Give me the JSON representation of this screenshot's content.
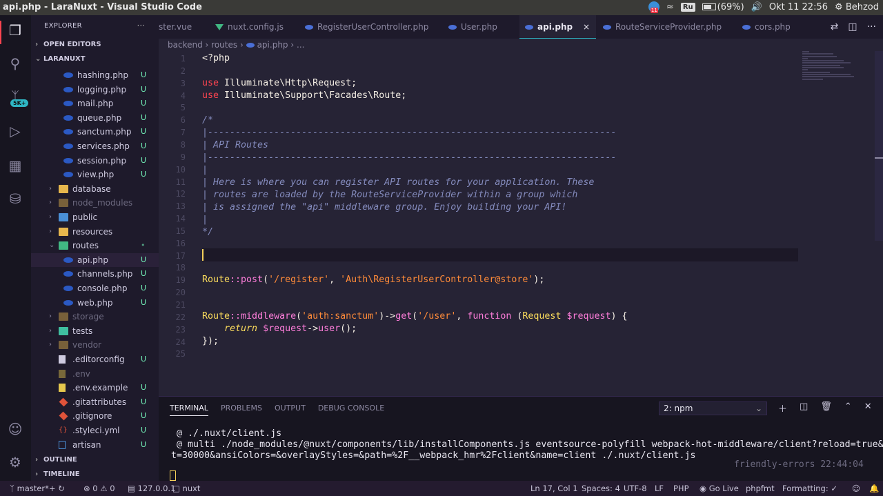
{
  "topbar": {
    "title": "api.php - LaraNuxt - Visual Studio Code",
    "keyboard": "Ru",
    "battery": "(69%)",
    "battery_level": 0.69,
    "datetime": "Okt 11 22:56",
    "user": "Behzod"
  },
  "sidebar": {
    "header": "EXPLORER",
    "dots": "···",
    "open_editors": "OPEN EDITORS",
    "project": "LARANUXT",
    "outline": "OUTLINE",
    "timeline": "TIMELINE",
    "items": [
      {
        "label": "hashing.php",
        "status": "U"
      },
      {
        "label": "logging.php",
        "status": "U"
      },
      {
        "label": "mail.php",
        "status": "U"
      },
      {
        "label": "queue.php",
        "status": "U"
      },
      {
        "label": "sanctum.php",
        "status": "U"
      },
      {
        "label": "services.php",
        "status": "U"
      },
      {
        "label": "session.php",
        "status": "U"
      },
      {
        "label": "view.php",
        "status": "U"
      },
      {
        "label": "database",
        "status": ""
      },
      {
        "label": "node_modules",
        "status": ""
      },
      {
        "label": "public",
        "status": ""
      },
      {
        "label": "resources",
        "status": ""
      },
      {
        "label": "routes",
        "status": ""
      },
      {
        "label": "api.php",
        "status": "U"
      },
      {
        "label": "channels.php",
        "status": "U"
      },
      {
        "label": "console.php",
        "status": "U"
      },
      {
        "label": "web.php",
        "status": "U"
      },
      {
        "label": "storage",
        "status": ""
      },
      {
        "label": "tests",
        "status": ""
      },
      {
        "label": "vendor",
        "status": ""
      },
      {
        "label": ".editorconfig",
        "status": "U"
      },
      {
        "label": ".env",
        "status": ""
      },
      {
        "label": ".env.example",
        "status": "U"
      },
      {
        "label": ".gitattributes",
        "status": "U"
      },
      {
        "label": ".gitignore",
        "status": "U"
      },
      {
        "label": ".styleci.yml",
        "status": "U"
      },
      {
        "label": "artisan",
        "status": "U"
      }
    ]
  },
  "tabs": [
    {
      "label": "ster.vue"
    },
    {
      "label": "nuxt.config.js"
    },
    {
      "label": "RegisterUserController.php"
    },
    {
      "label": "User.php"
    },
    {
      "label": "api.php",
      "close": "×"
    },
    {
      "label": "RouteServiceProvider.php"
    },
    {
      "label": "cors.php"
    }
  ],
  "breadcrumb": {
    "a": "backend",
    "b": "routes",
    "c": "api.php",
    "d": "..."
  },
  "editor": {
    "line_numbers": [
      "1",
      "2",
      "3",
      "4",
      "5",
      "6",
      "7",
      "8",
      "9",
      "10",
      "11",
      "12",
      "13",
      "14",
      "15",
      "16",
      "17",
      "18",
      "19",
      "20",
      "21",
      "22",
      "23",
      "24",
      "25"
    ],
    "code": {
      "l1": "<?php",
      "l3a": "use",
      "l3b": " Illuminate\\Http\\Request;",
      "l4a": "use",
      "l4b": " Illuminate\\Support\\Facades\\Route;",
      "l6": "/*",
      "l7": "|--------------------------------------------------------------------------",
      "l8": "| API Routes",
      "l9": "|--------------------------------------------------------------------------",
      "l10": "|",
      "l11": "| Here is where you can register API routes for your application. These",
      "l12": "| routes are loaded by the RouteServiceProvider within a group which",
      "l13": "| is assigned the \"api\" middleware group. Enjoy building your API!",
      "l14": "|",
      "l15": "*/",
      "l19a": "Route",
      "l19b": "::",
      "l19c": "post",
      "l19d": "(",
      "l19e": "'/register'",
      "l19f": ", ",
      "l19g": "'Auth\\RegisterUserController@store'",
      "l19h": ");",
      "l22a": "Route",
      "l22b": "::",
      "l22c": "middleware",
      "l22d": "(",
      "l22e": "'auth:sanctum'",
      "l22f": ")->",
      "l22g": "get",
      "l22h": "(",
      "l22i": "'/user'",
      "l22j": ", ",
      "l22k": "function",
      "l22l": " (",
      "l22m": "Request",
      "l22n": " $request",
      "l22o": ") {",
      "l23a": "    return",
      "l23b": " $request",
      "l23c": "->",
      "l23d": "user",
      "l23e": "();",
      "l24": "});"
    }
  },
  "panel": {
    "tabs": [
      "TERMINAL",
      "PROBLEMS",
      "OUTPUT",
      "DEBUG CONSOLE"
    ],
    "terminal_select": "2: npm",
    "lines": [
      " @ ./.nuxt/client.js",
      " @ multi ./node_modules/@nuxt/components/lib/installComponents.js eventsource-polyfill webpack-hot-middleware/client?reload=true&timeou",
      "t=30000&ansiColors=&overlayStyles=&path=%2F__webpack_hmr%2Fclient&name=client ./.nuxt/client.js"
    ],
    "time": "friendly-errors 22:44:04"
  },
  "status": {
    "branch": "master*+",
    "problems": "⊗ 0 ⚠ 0",
    "host": "127.0.0.1",
    "nuxt": "nuxt",
    "position": "Ln 17, Col 1",
    "spaces": "Spaces: 4",
    "encoding": "UTF-8",
    "eol": "LF",
    "lang": "PHP",
    "golive": "Go Live",
    "phpfmt": "phpfmt",
    "formatting": "Formatting: ✓"
  },
  "activity": {
    "badge": "5K+"
  }
}
